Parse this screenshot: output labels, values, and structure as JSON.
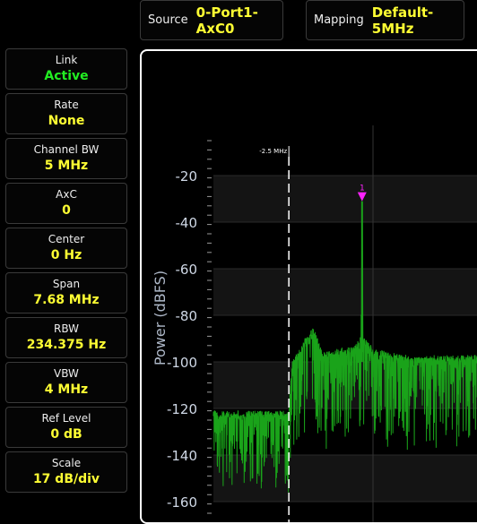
{
  "header": {
    "source_label": "Source",
    "source_value": "0-Port1-AxC0",
    "mapping_label": "Mapping",
    "mapping_value": "Default-5MHz"
  },
  "params": [
    {
      "label": "Link",
      "value": "Active",
      "value_color": "#22ee22"
    },
    {
      "label": "Rate",
      "value": "None"
    },
    {
      "label": "Channel BW",
      "value": "5 MHz"
    },
    {
      "label": "AxC",
      "value": "0"
    },
    {
      "label": "Center",
      "value": "0 Hz"
    },
    {
      "label": "Span",
      "value": "7.68 MHz"
    },
    {
      "label": "RBW",
      "value": "234.375 Hz"
    },
    {
      "label": "VBW",
      "value": "4 MHz"
    },
    {
      "label": "Ref Level",
      "value": "0 dB"
    },
    {
      "label": "Scale",
      "value": "17 dB/div"
    }
  ],
  "chart_data": {
    "type": "line",
    "ylabel": "Power (dBFS)",
    "yticks": [
      -20,
      -40,
      -60,
      -80,
      -100,
      -120,
      -140,
      -160
    ],
    "ylim": [
      -165,
      -5
    ],
    "xlim_visible_mhz": [
      -3.84,
      1.0
    ],
    "marker": {
      "label": "1",
      "x_mhz": -1.2,
      "y": -31,
      "color": "#ff22ff"
    },
    "channel_edge": {
      "label": "-2.5 MHz",
      "x_mhz": -2.5
    },
    "trace_color": "#1aa31a",
    "series": [
      {
        "points": [
          [
            -3.84,
            -124
          ],
          [
            -3.3,
            -124
          ],
          [
            -2.6,
            -124
          ],
          [
            -2.5,
            -124
          ],
          [
            -2.45,
            -103
          ],
          [
            -2.3,
            -97
          ],
          [
            -2.2,
            -92
          ],
          [
            -2.05,
            -88
          ],
          [
            -1.9,
            -99
          ],
          [
            -1.6,
            -97
          ],
          [
            -1.35,
            -96
          ],
          [
            -1.22,
            -92
          ],
          [
            -1.2,
            -31
          ],
          [
            -1.18,
            -92
          ],
          [
            -1.0,
            -97
          ],
          [
            -0.7,
            -99
          ],
          [
            -0.4,
            -100
          ],
          [
            -0.2,
            -101
          ],
          [
            0.1,
            -100
          ],
          [
            1.0,
            -100
          ]
        ]
      }
    ]
  }
}
